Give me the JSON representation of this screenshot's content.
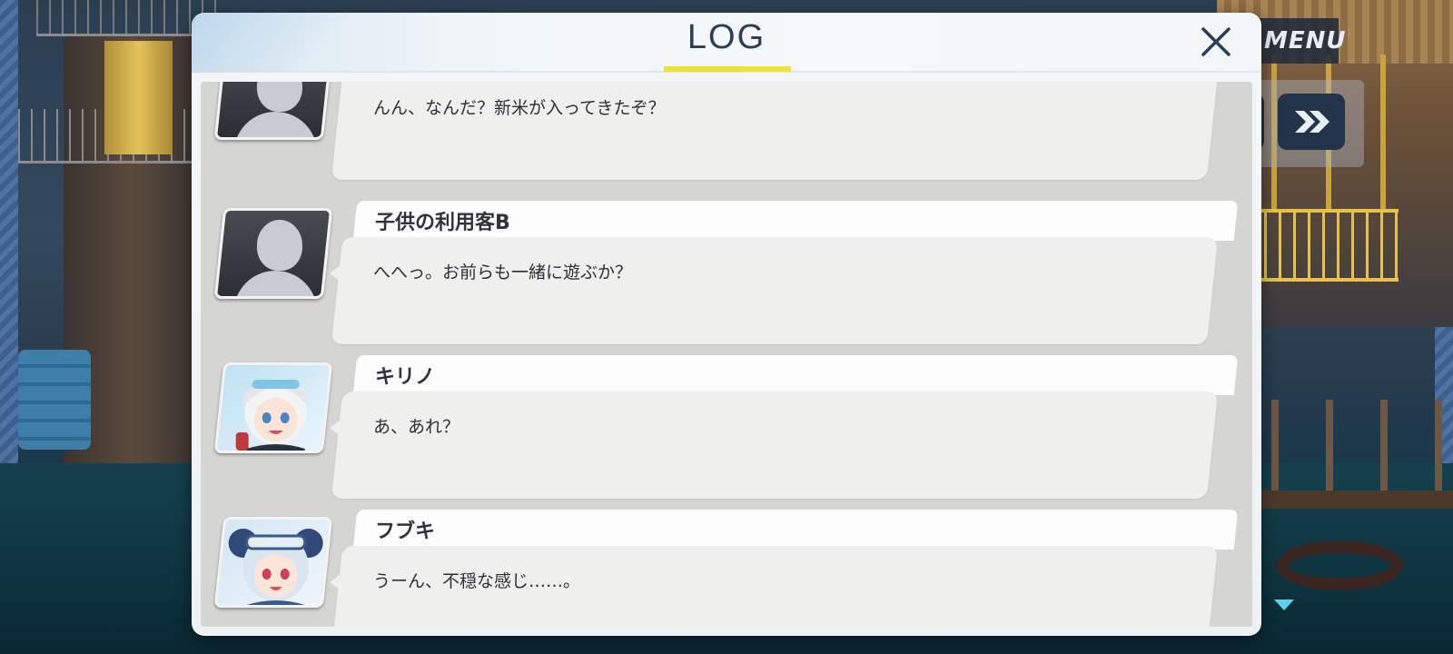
{
  "hud": {
    "menu_label": "MENU",
    "fast_forward_icon": "fast-forward-icon",
    "next_indicator_icon": "down-triangle-icon"
  },
  "log": {
    "title": "LOG",
    "close_icon": "close-icon",
    "entries": [
      {
        "speaker": "",
        "avatar": "silhouette",
        "text": "んん、なんだ？新米が入ってきたぞ？"
      },
      {
        "speaker": "子供の利用客B",
        "avatar": "silhouette",
        "text": "へへっ。お前らも一緒に遊ぶか？"
      },
      {
        "speaker": "キリノ",
        "avatar": "kirino-portrait",
        "text": "あ、あれ？"
      },
      {
        "speaker": "フブキ",
        "avatar": "fubuki-portrait",
        "text": "うーん、不穏な感じ……。"
      }
    ]
  },
  "colors": {
    "title_underline": "#f5e12a",
    "title_text": "#2a3e5a",
    "log_background": "#d5d5d3",
    "bubble": "#efefed",
    "name_tab": "#fdfdfd"
  }
}
